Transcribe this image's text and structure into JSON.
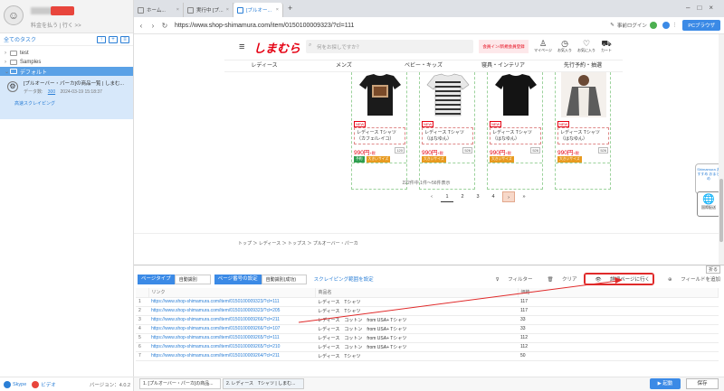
{
  "sidebar": {
    "subtitle": "料金を払う | 行く >>",
    "task_header": "全てのタスク",
    "tree": [
      {
        "label": "test"
      },
      {
        "label": "Samples"
      },
      {
        "label": "デフォルト"
      }
    ],
    "task": {
      "title": "[プルオーバー・パーカ]の商品一覧 | しまむ...",
      "meta_label": "データ数:",
      "meta_count": "300",
      "meta_date": "2024-03-19 15:18:37",
      "status": "高速スクレイピング"
    },
    "footer": {
      "skype": "Skype",
      "video": "ビデオ",
      "version": "バージョン：4.0.2"
    }
  },
  "browser": {
    "tabs": [
      {
        "label": "ホーム..."
      },
      {
        "label": "実行中 [プ..."
      },
      {
        "label": "[プルオー..."
      }
    ],
    "url": "https://www.shop-shimamura.com/item/0150100009323/?cl=111",
    "login_label": "事前ログイン",
    "pc_label": "PCブラウザ"
  },
  "site": {
    "logo": "しまむら",
    "search_placeholder": "何をお探しですか？",
    "promo": "会員イン/新規会員登録",
    "icons": [
      {
        "label": "マイページ",
        "icon": "person-icon"
      },
      {
        "label": "お気入り",
        "icon": "clock-icon"
      },
      {
        "label": "お気に入り",
        "icon": "heart-icon"
      },
      {
        "label": "カート",
        "icon": "cart-icon"
      }
    ],
    "categories": [
      "レディース",
      "メンズ",
      "ベビー・キッズ",
      "寝具・インテリア",
      "先行予約・抽選"
    ],
    "products": [
      {
        "badge": "NEW",
        "name": "レディース Tシャツ（カフェ/レイコ）",
        "price": "990円",
        "tax": "+税",
        "count": "120",
        "tags": [
          {
            "label": "予約",
            "color": "#2e9e4f"
          },
          {
            "label": "大きいサイズ",
            "color": "#e89a1f"
          }
        ]
      },
      {
        "badge": "NEW",
        "name": "レディース Tシャツ（はなゆん）",
        "price": "990円",
        "tax": "+税",
        "count": "526",
        "tags": [
          {
            "label": "大きいサイズ",
            "color": "#e89a1f"
          }
        ]
      },
      {
        "badge": "NEW",
        "name": "レディース Tシャツ（はなゆん）",
        "price": "990円",
        "tax": "+税",
        "count": "526",
        "tags": [
          {
            "label": "大きいサイズ",
            "color": "#e89a1f"
          }
        ]
      },
      {
        "badge": "NEW",
        "name": "レディース Tシャツ（はなゆん）",
        "price": "990円",
        "tax": "+税",
        "count": "526",
        "tags": [
          {
            "label": "大きいサイズ",
            "color": "#e89a1f"
          }
        ]
      }
    ],
    "results_text": "222件中 1件〜56件表示",
    "pages": [
      "‹",
      "1",
      "2",
      "3",
      "4",
      "›",
      "»"
    ],
    "floating": "Shimamura おすすめ おまとめ",
    "globe_label": "国際配送",
    "breadcrumb": "トップ ＞ レディース ＞ トップス ＞ プルオーバー・パーカ"
  },
  "panel": {
    "collapse": "折る",
    "page_type_label": "ページタイプ",
    "page_type_value": "自動識別",
    "paging_label": "ページ番号の設定",
    "paging_value": "自動識別(成功)",
    "scrape_range": "スクレイピング範囲を設定",
    "filter": "フィルター",
    "clear": "クリア",
    "goto_detail": "詳細ページに行く",
    "add_field": "フィールドを追加",
    "columns": [
      "リンク",
      "商品名",
      "価格"
    ],
    "rows": [
      {
        "idx": "1",
        "link": "https://www.shop-shimamura.com/item/0150100009323/?cl=111",
        "name": "レディース　Tシャツ",
        "price": "117"
      },
      {
        "idx": "2",
        "link": "https://www.shop-shimamura.com/item/0150100009323/?cl=205",
        "name": "レディース　Tシャツ",
        "price": "117"
      },
      {
        "idx": "3",
        "link": "https://www.shop-shimamura.com/item/0150100009266/?cl=211",
        "name": "レディース　コットン　from USA+ Tシャツ",
        "price": "33"
      },
      {
        "idx": "4",
        "link": "https://www.shop-shimamura.com/item/0150100009266/?cl=107",
        "name": "レディース　コットン　from USA+ Tシャツ",
        "price": "33"
      },
      {
        "idx": "5",
        "link": "https://www.shop-shimamura.com/item/0150100009265/?cl=111",
        "name": "レディース　コットン　from USA+ Tシャツ",
        "price": "112"
      },
      {
        "idx": "6",
        "link": "https://www.shop-shimamura.com/item/0150100009265/?cl=210",
        "name": "レディース　コットン　from USA+ Tシャツ",
        "price": "112"
      },
      {
        "idx": "7",
        "link": "https://www.shop-shimamura.com/item/0150100009264/?cl=211",
        "name": "レディース　Tシャツ",
        "price": "50"
      }
    ],
    "bottom_tabs": [
      "1. [プルオーバー・パーカ]の商品...",
      "2. レディース　Tシャツ | しまむ..."
    ],
    "start": "起動",
    "save": "保存"
  },
  "colors": {
    "accent": "#3b8ae6",
    "brand": "#e50012",
    "annotation": "#e02a2a"
  }
}
